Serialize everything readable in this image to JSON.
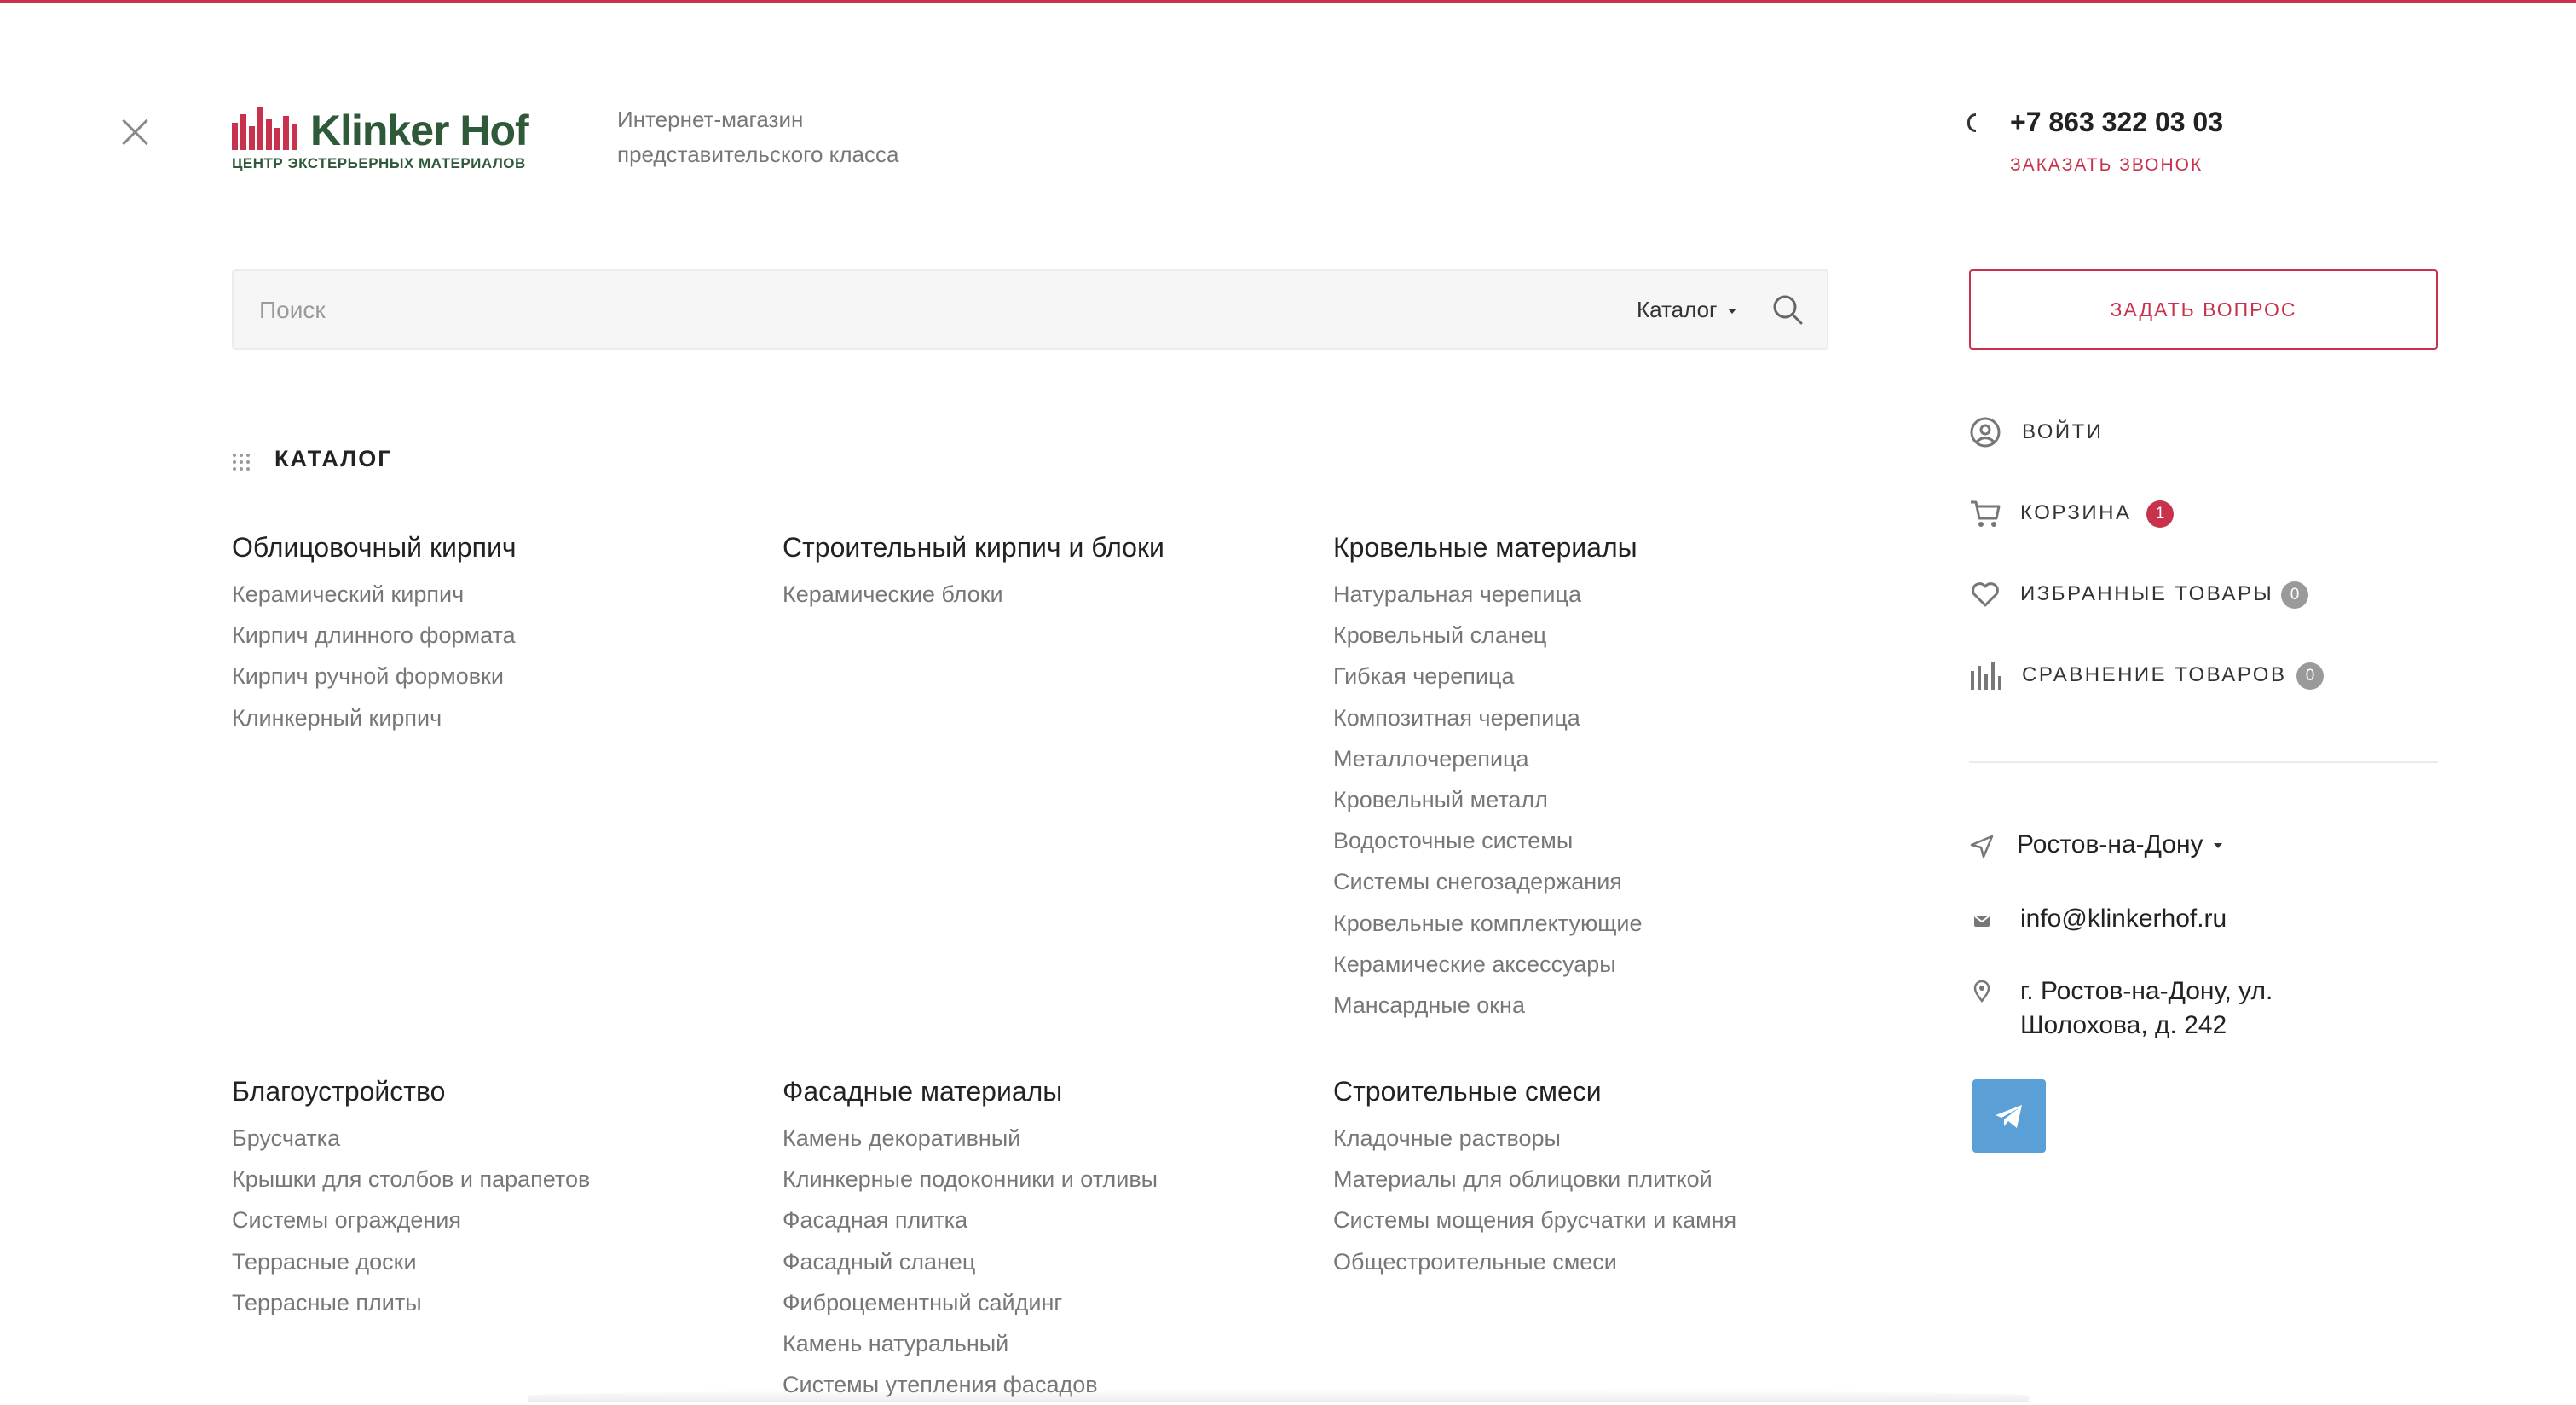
{
  "header": {
    "logo": {
      "name": "Klinker Hof",
      "tagline": "ЦЕНТР ЭКСТЕРЬЕРНЫХ МАТЕРИАЛОВ"
    },
    "description_line1": "Интернет-магазин",
    "description_line2": "представительского класса",
    "phone": "+7 863 322 03 03",
    "callback_label": "ЗАКАЗАТЬ ЗВОНОК"
  },
  "search": {
    "placeholder": "Поиск",
    "value": "",
    "scope_label": "Каталог"
  },
  "catalog": {
    "title": "КАТАЛОГ",
    "columns": [
      {
        "heading": "Облицовочный кирпич",
        "items": [
          "Керамический кирпич",
          "Кирпич длинного формата",
          "Кирпич ручной формовки",
          "Клинкерный кирпич"
        ]
      },
      {
        "heading": "Строительный кирпич и блоки",
        "items": [
          "Керамические блоки"
        ]
      },
      {
        "heading": "Кровельные материалы",
        "items": [
          "Натуральная черепица",
          "Кровельный сланец",
          "Гибкая черепица",
          "Композитная черепица",
          "Металлочерепица",
          "Кровельный металл",
          "Водосточные системы",
          "Системы снегозадержания",
          "Кровельные комплектующие",
          "Керамические аксессуары",
          "Мансардные окна"
        ]
      },
      {
        "heading": "Благоустройство",
        "items": [
          "Брусчатка",
          "Крышки для столбов и парапетов",
          "Системы ограждения",
          "Террасные доски",
          "Террасные плиты"
        ]
      },
      {
        "heading": "Фасадные материалы",
        "items": [
          "Камень декоративный",
          "Клинкерные подоконники и отливы",
          "Фасадная плитка",
          "Фасадный сланец",
          "Фиброцементный сайдинг",
          "Камень натуральный",
          "Системы утепления фасадов"
        ]
      },
      {
        "heading": "Строительные смеси",
        "items": [
          "Кладочные растворы",
          "Материалы для облицовки плиткой",
          "Системы мощения брусчатки и камня",
          "Общестроительные смеси"
        ]
      }
    ]
  },
  "sidebar": {
    "ask_button": "ЗАДАТЬ ВОПРОС",
    "login": "ВОЙТИ",
    "cart": {
      "label": "КОРЗИНА",
      "count": "1"
    },
    "favorites": {
      "label": "ИЗБРАННЫЕ ТОВАРЫ",
      "count": "0"
    },
    "compare": {
      "label": "СРАВНЕНИЕ ТОВАРОВ",
      "count": "0"
    },
    "city": "Ростов-на-Дону",
    "email": "info@klinkerhof.ru",
    "address": "г. Ростов-на-Дону, ул. Шолохова, д. 242"
  },
  "icons": {
    "close": "close-icon",
    "search": "search-icon",
    "grid": "grid-icon",
    "user": "user-icon",
    "cart": "cart-icon",
    "heart": "heart-icon",
    "compare": "bar-chart-icon",
    "location": "navigation-arrow-icon",
    "mail": "mail-icon",
    "pin": "map-pin-icon",
    "telegram": "telegram-icon"
  },
  "colors": {
    "accent": "#c8324c",
    "brand_green": "#2e5a3a",
    "telegram": "#5a9fd6",
    "muted_text": "#777777"
  }
}
